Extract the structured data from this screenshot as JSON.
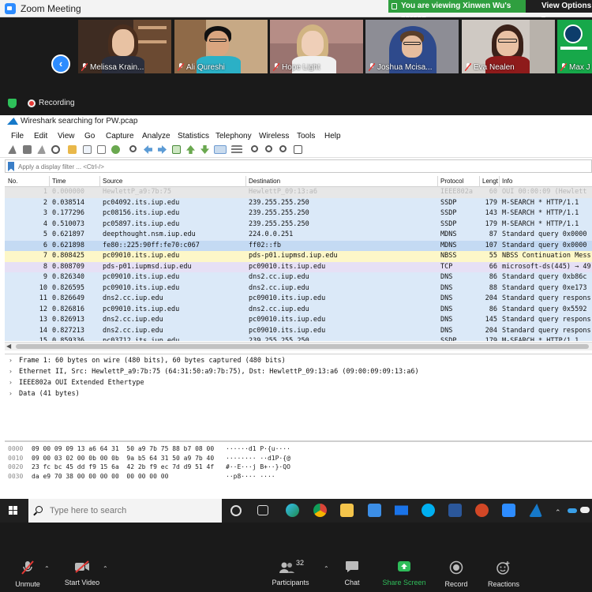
{
  "zoom": {
    "window_title": "Zoom Meeting",
    "viewing_banner": "You are viewing Xinwen Wu's screen",
    "view_options": "View Options ▾",
    "recording_label": "Recording",
    "participants": [
      {
        "name": "Melissa Krain..."
      },
      {
        "name": "Ali Qureshi"
      },
      {
        "name": "Hope Light"
      },
      {
        "name": "Joshua Mcisa..."
      },
      {
        "name": "Eva Nealen"
      },
      {
        "name": "Max Ju"
      }
    ],
    "controls": {
      "unmute": "Unmute",
      "start_video": "Start Video",
      "participants": "Participants",
      "participants_count": "32",
      "chat": "Chat",
      "share_screen": "Share Screen",
      "record": "Record",
      "reactions": "Reactions"
    },
    "colors": {
      "accent": "#2d8cff",
      "banner": "#2f9f3f",
      "share": "#2fbd5a",
      "recording": "#e53935"
    }
  },
  "wireshark": {
    "title": "Wireshark searching for PW.pcap",
    "menu": [
      "File",
      "Edit",
      "View",
      "Go",
      "Capture",
      "Analyze",
      "Statistics",
      "Telephony",
      "Wireless",
      "Tools",
      "Help"
    ],
    "filter_placeholder": "Apply a display filter ... <Ctrl-/>",
    "columns": [
      "No.",
      "Time",
      "Source",
      "Destination",
      "Protocol",
      "Lengt",
      "Info"
    ],
    "packets": [
      {
        "no": "1",
        "time": "0.000000",
        "src": "HewlettP_a9:7b:75",
        "dst": "HewlettP_09:13:a6",
        "proto": "IEEE802a",
        "len": "60",
        "info": "OUI 00:00:09 (Hewlett",
        "bg": "#e7e7e7",
        "fg": "#b8b8b8"
      },
      {
        "no": "2",
        "time": "0.038514",
        "src": "pc04092.its.iup.edu",
        "dst": "239.255.255.250",
        "proto": "SSDP",
        "len": "179",
        "info": "M-SEARCH * HTTP/1.1",
        "bg": "#dbe9f8",
        "fg": "#111111"
      },
      {
        "no": "3",
        "time": "0.177296",
        "src": "pc08156.its.iup.edu",
        "dst": "239.255.255.250",
        "proto": "SSDP",
        "len": "143",
        "info": "M-SEARCH * HTTP/1.1",
        "bg": "#dbe9f8",
        "fg": "#111111"
      },
      {
        "no": "4",
        "time": "0.510073",
        "src": "pc05897.its.iup.edu",
        "dst": "239.255.255.250",
        "proto": "SSDP",
        "len": "179",
        "info": "M-SEARCH * HTTP/1.1",
        "bg": "#dbe9f8",
        "fg": "#111111"
      },
      {
        "no": "5",
        "time": "0.621897",
        "src": "deepthought.nsm.iup.edu",
        "dst": "224.0.0.251",
        "proto": "MDNS",
        "len": "87",
        "info": "Standard query 0x0000",
        "bg": "#dbe9f8",
        "fg": "#111111"
      },
      {
        "no": "6",
        "time": "0.621898",
        "src": "fe80::225:90ff:fe70:c067",
        "dst": "ff02::fb",
        "proto": "MDNS",
        "len": "107",
        "info": "Standard query 0x0000",
        "bg": "#c4daf3",
        "fg": "#111111"
      },
      {
        "no": "7",
        "time": "0.808425",
        "src": "pc09010.its.iup.edu",
        "dst": "pds-p01.iupmsd.iup.edu",
        "proto": "NBSS",
        "len": "55",
        "info": "NBSS Continuation Mess",
        "bg": "#fdf7c8",
        "fg": "#111111"
      },
      {
        "no": "8",
        "time": "0.808709",
        "src": "pds-p01.iupmsd.iup.edu",
        "dst": "pc09010.its.iup.edu",
        "proto": "TCP",
        "len": "66",
        "info": "microsoft-ds(445) → 49",
        "bg": "#e6e0f5",
        "fg": "#111111"
      },
      {
        "no": "9",
        "time": "0.826340",
        "src": "pc09010.its.iup.edu",
        "dst": "dns2.cc.iup.edu",
        "proto": "DNS",
        "len": "86",
        "info": "Standard query 0xb86c",
        "bg": "#dbe9f8",
        "fg": "#111111"
      },
      {
        "no": "10",
        "time": "0.826595",
        "src": "pc09010.its.iup.edu",
        "dst": "dns2.cc.iup.edu",
        "proto": "DNS",
        "len": "88",
        "info": "Standard query 0xe173",
        "bg": "#dbe9f8",
        "fg": "#111111"
      },
      {
        "no": "11",
        "time": "0.826649",
        "src": "dns2.cc.iup.edu",
        "dst": "pc09010.its.iup.edu",
        "proto": "DNS",
        "len": "204",
        "info": "Standard query respons",
        "bg": "#dbe9f8",
        "fg": "#111111"
      },
      {
        "no": "12",
        "time": "0.826816",
        "src": "pc09010.its.iup.edu",
        "dst": "dns2.cc.iup.edu",
        "proto": "DNS",
        "len": "86",
        "info": "Standard query 0x5592",
        "bg": "#dbe9f8",
        "fg": "#111111"
      },
      {
        "no": "13",
        "time": "0.826913",
        "src": "dns2.cc.iup.edu",
        "dst": "pc09010.its.iup.edu",
        "proto": "DNS",
        "len": "145",
        "info": "Standard query respons",
        "bg": "#dbe9f8",
        "fg": "#111111"
      },
      {
        "no": "14",
        "time": "0.827213",
        "src": "dns2.cc.iup.edu",
        "dst": "pc09010.its.iup.edu",
        "proto": "DNS",
        "len": "204",
        "info": "Standard query respons",
        "bg": "#dbe9f8",
        "fg": "#111111"
      },
      {
        "no": "15",
        "time": "0.859336",
        "src": "pc03712.its.iup.edu",
        "dst": "239.255.255.250",
        "proto": "SSDP",
        "len": "179",
        "info": "M-SEARCH * HTTP/1.1",
        "bg": "#dbe9f8",
        "fg": "#111111"
      }
    ],
    "details": [
      "Frame 1: 60 bytes on wire (480 bits), 60 bytes captured (480 bits)",
      "Ethernet II, Src: HewlettP_a9:7b:75 (64:31:50:a9:7b:75), Dst: HewlettP_09:13:a6 (09:00:09:09:13:a6)",
      "IEEE802a OUI Extended Ethertype",
      "Data (41 bytes)"
    ],
    "bytes": [
      {
        "offset": "0000",
        "hex": "09 00 09 09 13 a6 64 31  50 a9 7b 75 88 b7 08 00",
        "ascii": "······d1 P·{u····"
      },
      {
        "offset": "0010",
        "hex": "09 00 03 02 00 0b 00 0b  9a b5 64 31 50 a9 7b 40",
        "ascii": "········ ··d1P·{@"
      },
      {
        "offset": "0020",
        "hex": "23 fc bc 45 dd f9 15 6a  42 2b f9 ec 7d d9 51 4f",
        "ascii": "#··E···j B+··}·QO"
      },
      {
        "offset": "0030",
        "hex": "da e9 70 38 00 00 00 00  00 00 00 00",
        "ascii": "··p8···· ····"
      }
    ]
  },
  "taskbar": {
    "search_placeholder": "Type here to search",
    "apps": [
      "task-view-icon",
      "timeline-icon",
      "edge-icon",
      "chrome-icon",
      "file-explorer-icon",
      "store-icon",
      "mail-icon",
      "skype-icon",
      "word-icon",
      "powerpoint-icon",
      "zoom-app-icon",
      "wireshark-app-icon"
    ]
  }
}
